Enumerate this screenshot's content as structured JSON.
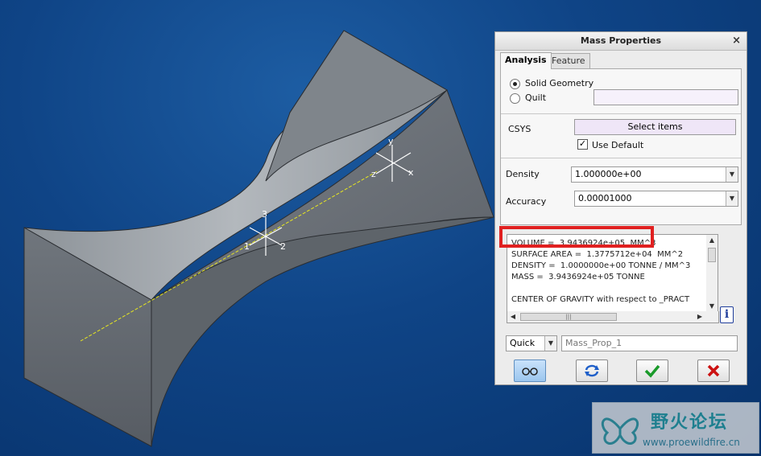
{
  "viewport": {
    "csys_part": {
      "x": "x",
      "y": "y",
      "z": "z"
    },
    "csys_center": {
      "one": "1",
      "two": "2",
      "three": "3"
    }
  },
  "dialog": {
    "title": "Mass Properties",
    "close_glyph": "×",
    "tabs": [
      {
        "label": "Analysis",
        "active": true
      },
      {
        "label": "Feature",
        "active": false
      }
    ],
    "geometry_options": [
      {
        "label": "Solid Geometry",
        "selected": true
      },
      {
        "label": "Quilt",
        "selected": false
      }
    ],
    "csys_label": "CSYS",
    "select_items_label": "Select items",
    "use_default": {
      "label": "Use Default",
      "checked": true
    },
    "density": {
      "label": "Density",
      "value": "1.000000e+00"
    },
    "accuracy": {
      "label": "Accuracy",
      "value": "0.00001000"
    },
    "results_lines": [
      "VOLUME =  3.9436924e+05  MM^3",
      "SURFACE AREA =  1.3775712e+04  MM^2",
      "DENSITY =  1.0000000e+00 TONNE / MM^3",
      "MASS =  3.9436924e+05 TONNE",
      "",
      "CENTER OF GRAVITY with respect to _PRACT"
    ],
    "hscroll_grip": "|||",
    "info_icon": "i",
    "mode": {
      "value": "Quick"
    },
    "analysis_name": "Mass_Prop_1",
    "buttons": [
      {
        "name": "glasses-icon",
        "label": "Preview"
      },
      {
        "name": "repeat-icon",
        "label": "Repeat"
      },
      {
        "name": "checkmark-icon",
        "label": "OK"
      },
      {
        "name": "close-icon",
        "label": "Cancel"
      }
    ],
    "colors": {
      "ok": "#1a9a2a",
      "cancel": "#cc1111",
      "repeat": "#1f5fc9",
      "highlight": "#e02020"
    }
  },
  "watermark": {
    "cn": "野火论坛",
    "url": "www.proewildfire.cn"
  }
}
